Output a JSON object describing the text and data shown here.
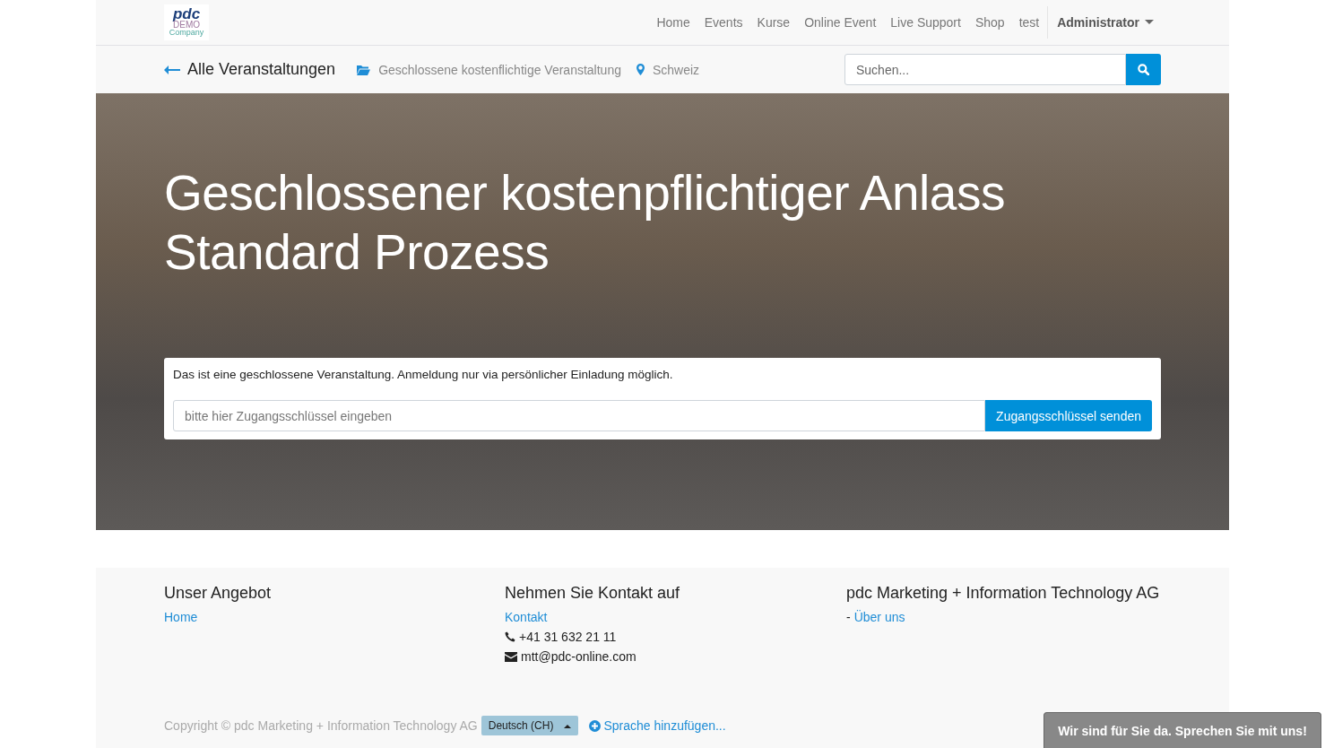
{
  "logo": {
    "lines": [
      "pdc",
      "DEMO",
      "Company"
    ]
  },
  "nav": {
    "items": [
      {
        "label": "Home"
      },
      {
        "label": "Events"
      },
      {
        "label": "Kurse"
      },
      {
        "label": "Online Event"
      },
      {
        "label": "Live Support"
      },
      {
        "label": "Shop"
      },
      {
        "label": "test"
      }
    ],
    "user": "Administrator"
  },
  "subnav": {
    "back": "Alle Veranstaltungen",
    "category": "Geschlossene kostenflichtige Veranstaltung",
    "location": "Schweiz",
    "search": {
      "placeholder": "Suchen..."
    }
  },
  "hero": {
    "title_lines": [
      "Geschlossener kostenpflichtiger Anlass",
      "Standard Prozess"
    ],
    "notice": "Das ist eine geschlossene Veranstaltung. Anmeldung nur via persönlicher Einladung möglich.",
    "key_field": {
      "placeholder": "bitte hier Zugangsschlüssel eingeben"
    },
    "key_button": "Zugangsschlüssel senden"
  },
  "footer": {
    "columns": [
      {
        "heading": "Unser Angebot",
        "links": [
          "Home"
        ]
      },
      {
        "heading": "Nehmen Sie Kontakt auf",
        "links": [
          "Kontakt"
        ],
        "phone": "+41 31 632 21 11",
        "email": "mtt@pdc-online.com"
      },
      {
        "heading": "pdc Marketing + Information Technology AG",
        "prefix": "-",
        "links": [
          "Über uns"
        ]
      }
    ],
    "copyright": "Copyright © pdc Marketing + Information Technology AG",
    "language": "Deutsch (CH)",
    "add_language": "Sprache hinzufügen..."
  },
  "chat_button": "Wir sind für Sie da. Sprechen Sie mit uns!"
}
